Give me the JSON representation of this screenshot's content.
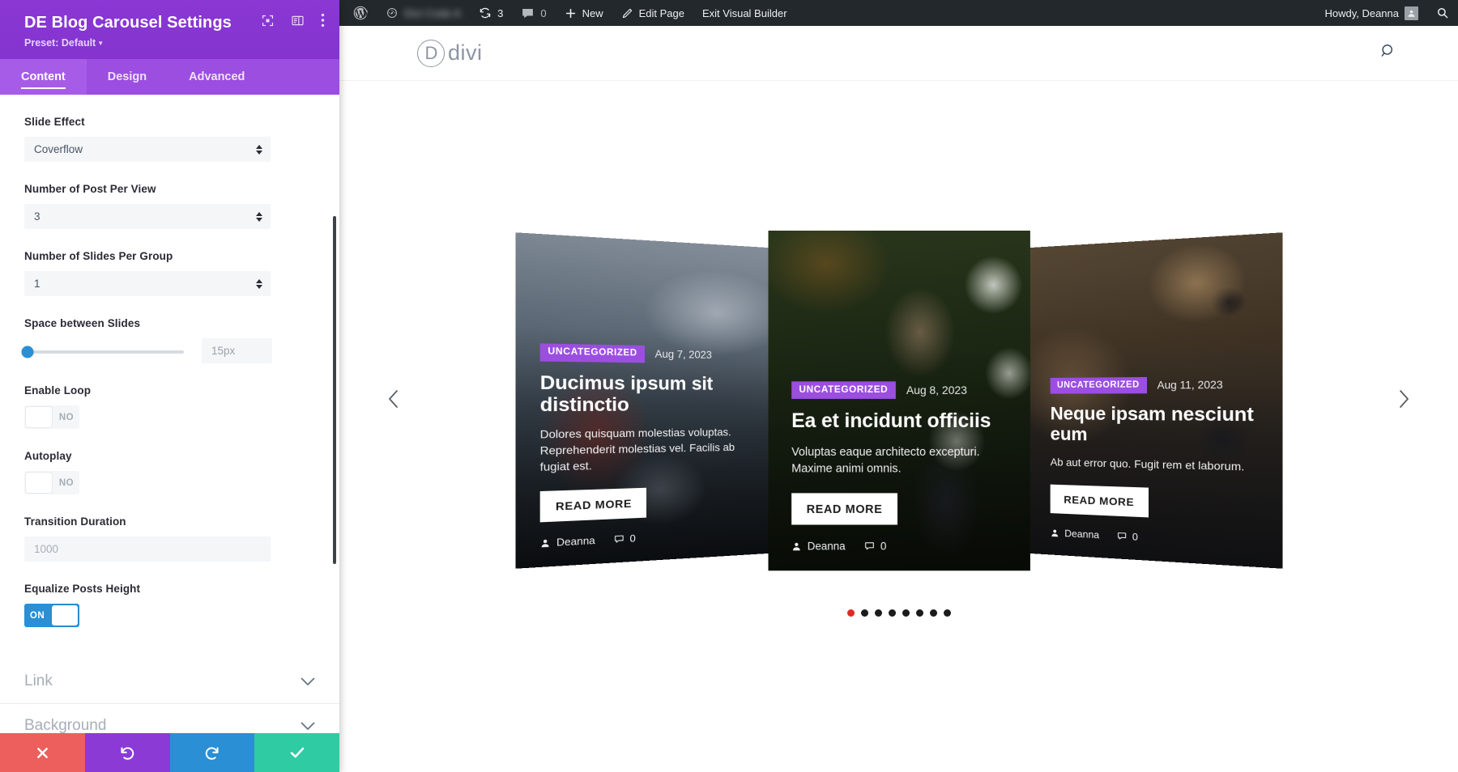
{
  "settings_panel": {
    "title": "DE Blog Carousel Settings",
    "preset_label": "Preset: Default",
    "header_icons": [
      "focus-frame-icon",
      "layout-panel-icon",
      "kebab-menu-icon"
    ],
    "tabs": [
      {
        "label": "Content",
        "active": true
      },
      {
        "label": "Design",
        "active": false
      },
      {
        "label": "Advanced",
        "active": false
      }
    ],
    "fields": {
      "slide_effect": {
        "label": "Slide Effect",
        "value": "Coverflow"
      },
      "posts_per_view": {
        "label": "Number of Post Per View",
        "value": "3"
      },
      "slides_group": {
        "label": "Number of Slides Per Group",
        "value": "1"
      },
      "space_slides": {
        "label": "Space between Slides",
        "value": "15px",
        "slider_percent": 2
      },
      "enable_loop": {
        "label": "Enable Loop",
        "value": "NO",
        "on": false
      },
      "autoplay": {
        "label": "Autoplay",
        "value": "NO",
        "on": false
      },
      "transition": {
        "label": "Transition Duration",
        "value": "1000"
      },
      "equalize": {
        "label": "Equalize Posts Height",
        "value": "ON",
        "on": true
      }
    },
    "collapsed_sections": [
      {
        "label": "Link"
      },
      {
        "label": "Background"
      }
    ],
    "footer_buttons": [
      {
        "name": "cancel-button",
        "icon": "close-icon",
        "color": "#ec5f5d"
      },
      {
        "name": "undo-button",
        "icon": "undo-icon",
        "color": "#8b3ad6"
      },
      {
        "name": "redo-button",
        "icon": "redo-icon",
        "color": "#2a8fd4"
      },
      {
        "name": "save-button",
        "icon": "check-icon",
        "color": "#2fcba2"
      }
    ],
    "accent_color": "#8b3ad6"
  },
  "admin_bar": {
    "site_name": "Divi Code A",
    "revision_count": "3",
    "comment_count": "0",
    "new_label": "New",
    "edit_page_label": "Edit Page",
    "exit_builder_label": "Exit Visual Builder",
    "howdy_label": "Howdy, Deanna",
    "background": "#23282d"
  },
  "site_header": {
    "logo_letter": "D",
    "logo_word": "divi",
    "search_icon": "search-icon"
  },
  "carousel": {
    "prev_label": "previous-slide",
    "next_label": "next-slide",
    "active_dot_color": "#e02b20",
    "dot_color": "#1b1b1b",
    "dots_total": 8,
    "dots_active_index": 0,
    "slides": [
      {
        "category": "UNCATEGORIZED",
        "date": "Aug 7, 2023",
        "title": "Ducimus ipsum sit distinctio",
        "excerpt": "Dolores quisquam molestias voluptas. Reprehenderit molestias vel. Facilis ab fugiat est.",
        "read_more": "READ MORE",
        "author": "Deanna",
        "comments": "0",
        "image": "mountain-motorcycle"
      },
      {
        "category": "UNCATEGORIZED",
        "date": "Aug 8, 2023",
        "title": "Ea et incidunt officiis",
        "excerpt": "Voluptas eaque architecto excepturi. Maxime animi omnis.",
        "read_more": "READ MORE",
        "author": "Deanna",
        "comments": "0",
        "image": "woman-flowers"
      },
      {
        "category": "UNCATEGORIZED",
        "date": "Aug 11, 2023",
        "title": "Neque ipsam nesciunt eum",
        "excerpt": "Ab aut error quo. Fugit rem et laborum.",
        "read_more": "READ MORE",
        "author": "Deanna",
        "comments": "0",
        "image": "dog-closeup"
      }
    ]
  }
}
